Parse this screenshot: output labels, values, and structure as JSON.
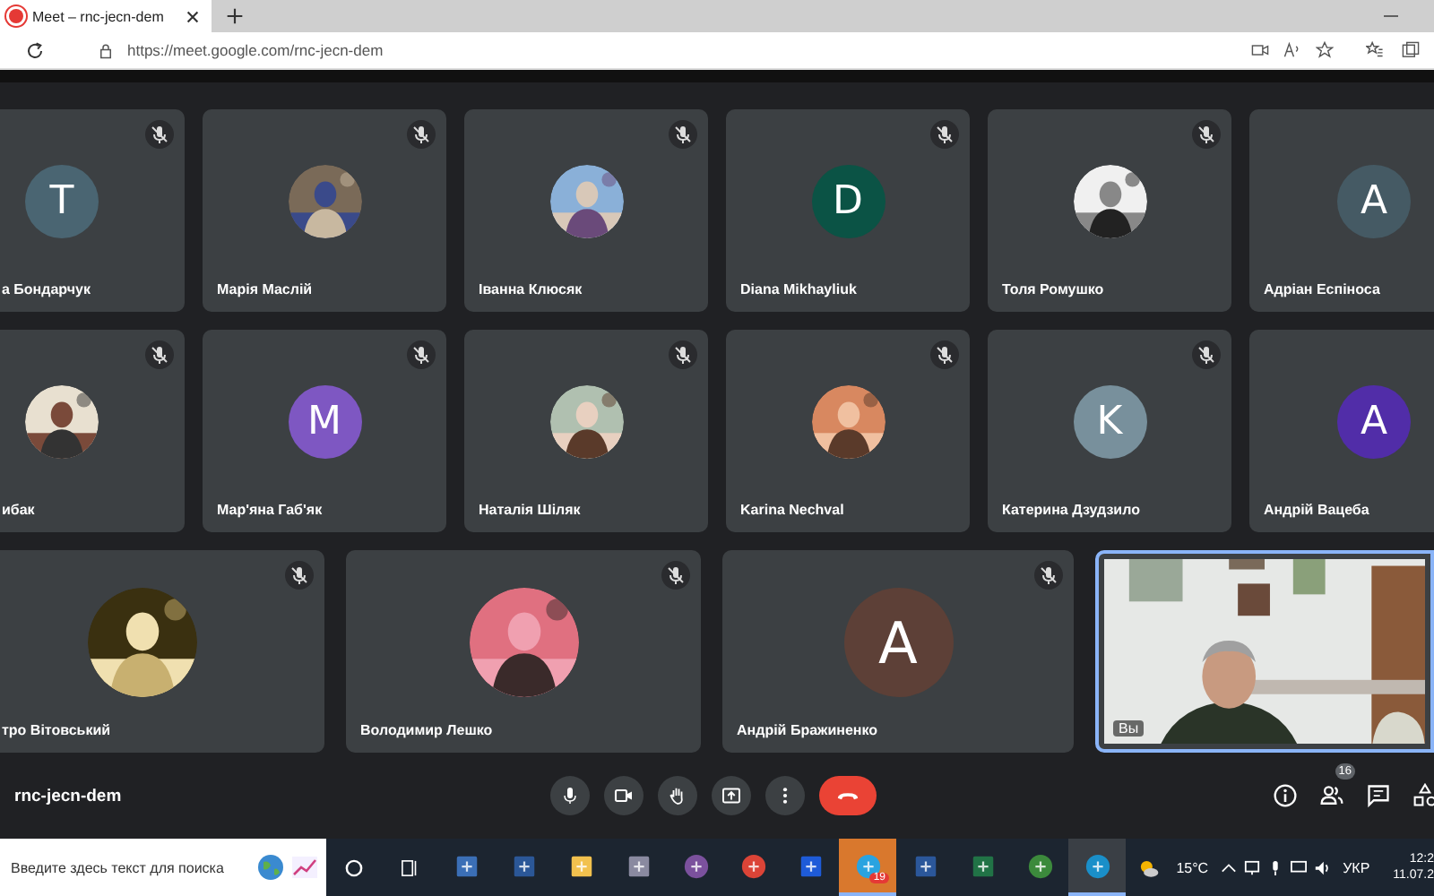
{
  "browser": {
    "tab_title": "Meet – rnc-jecn-dem",
    "url": "https://meet.google.com/rnc-jecn-dem"
  },
  "meeting": {
    "rows": [
      {
        "tiles": [
          {
            "kind": "avatar",
            "name": "а Бондарчук",
            "muted": true,
            "avatar": {
              "kind": "letter",
              "letter": "T",
              "color": "#4a6572"
            }
          },
          {
            "kind": "avatar",
            "name": "Марія Маслій",
            "muted": true
          },
          {
            "kind": "avatar",
            "name": "Іванна Клюсяк",
            "muted": true
          },
          {
            "kind": "avatar",
            "name": "Diana Mikhayliuk",
            "muted": true,
            "avatar": {
              "kind": "letter",
              "letter": "D",
              "color": "#0b5345"
            }
          },
          {
            "kind": "avatar",
            "name": "Толя Ромушко",
            "muted": true
          },
          {
            "kind": "avatar",
            "name": "Адріан Еспіноса",
            "muted": false,
            "avatar": {
              "kind": "letter",
              "letter": "A",
              "color": "#455a64"
            }
          }
        ]
      },
      {
        "tiles": [
          {
            "kind": "avatar",
            "name": "ибак",
            "muted": true
          },
          {
            "kind": "avatar",
            "name": "Мар'яна Габ'як",
            "muted": true,
            "avatar": {
              "kind": "letter",
              "letter": "M",
              "color": "#7e57c2"
            }
          },
          {
            "kind": "avatar",
            "name": "Наталія Шіляк",
            "muted": true
          },
          {
            "kind": "avatar",
            "name": "Karina Nechval",
            "muted": true
          },
          {
            "kind": "avatar",
            "name": "Катерина Дзудзило",
            "muted": true,
            "avatar": {
              "kind": "letter",
              "letter": "K",
              "color": "#78909c"
            }
          },
          {
            "kind": "avatar",
            "name": "Андрій Вацеба",
            "muted": false,
            "avatar": {
              "kind": "letter",
              "letter": "A",
              "color": "#512da8"
            }
          }
        ]
      },
      {
        "tiles": [
          {
            "kind": "avatar",
            "name": "тро Вітовський",
            "muted": true
          },
          {
            "kind": "avatar",
            "name": "Володимир Лешко",
            "muted": true
          },
          {
            "kind": "avatar",
            "name": "Андрій Бражиненко",
            "muted": true,
            "avatar": {
              "kind": "letter",
              "letter": "A",
              "color": "#5d4037"
            }
          },
          {
            "kind": "video",
            "name": "Вы",
            "muted": false
          }
        ]
      }
    ],
    "meeting_code": "rnc-jecn-dem",
    "people_count": "16"
  },
  "taskbar": {
    "search": {
      "placeholder": "Введите здесь текст для поиска"
    },
    "apps": [
      {
        "kind": "calculator",
        "active": false
      },
      {
        "kind": "save",
        "active": false
      },
      {
        "kind": "folder",
        "active": false
      },
      {
        "kind": "tool",
        "active": false
      },
      {
        "kind": "viber",
        "active": false
      },
      {
        "kind": "chrome",
        "active": false
      },
      {
        "kind": "blue",
        "active": false
      },
      {
        "kind": "telegram",
        "active": true,
        "badge": "19"
      },
      {
        "kind": "word",
        "active": false
      },
      {
        "kind": "excel",
        "active": false
      },
      {
        "kind": "green",
        "active": false
      },
      {
        "kind": "edge",
        "active": true
      }
    ],
    "temperature": "15°C",
    "language": "УКР",
    "time": "12:2",
    "date": "11.07.2"
  }
}
